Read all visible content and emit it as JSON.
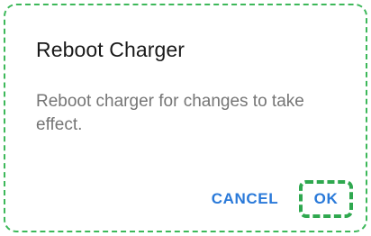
{
  "dialog": {
    "title": "Reboot Charger",
    "message": "Reboot charger for changes to take effect.",
    "buttons": {
      "cancel_label": "CANCEL",
      "ok_label": "OK"
    }
  },
  "colors": {
    "accent": "#2979d9",
    "highlight_outline": "#2fa84f",
    "title_text": "#1a1a1a",
    "body_text": "#757575"
  }
}
